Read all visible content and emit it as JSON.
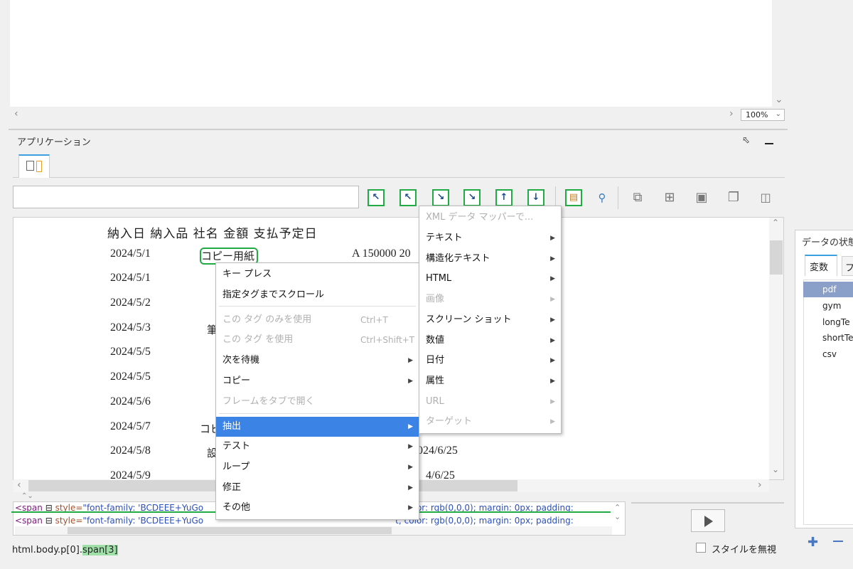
{
  "zoom": "100%",
  "panel_title": "アプリケーション",
  "document": {
    "header": "納入日 納入品 社名 金額 支払予定日",
    "rows": [
      {
        "date": "2024/5/1",
        "item": "コピー用紙",
        "tail": "A 150000 20"
      },
      {
        "date": "2024/5/1",
        "item": "",
        "tail": ""
      },
      {
        "date": "2024/5/2",
        "item": "",
        "tail": ""
      },
      {
        "date": "2024/5/3",
        "item": "筆",
        "tail": ""
      },
      {
        "date": "2024/5/5",
        "item": "",
        "tail": ""
      },
      {
        "date": "2024/5/5",
        "item": "",
        "tail": ""
      },
      {
        "date": "2024/5/6",
        "item": "",
        "tail": ""
      },
      {
        "date": "2024/5/7",
        "item": "コピ",
        "tail": ""
      },
      {
        "date": "2024/5/8",
        "item": "設",
        "tail": "024/6/25"
      },
      {
        "date": "2024/5/9",
        "item": "",
        "tail": "4/6/25"
      }
    ]
  },
  "context_menu": {
    "items": [
      {
        "label": "キー プレス",
        "disabled": false,
        "submenu": false
      },
      {
        "label": "指定タグまでスクロール",
        "disabled": false,
        "submenu": false
      },
      {
        "label": "この タグ のみを使用",
        "shortcut": "Ctrl+T",
        "disabled": true,
        "submenu": false
      },
      {
        "label": "この タグ を使用",
        "shortcut": "Ctrl+Shift+T",
        "disabled": true,
        "submenu": false
      },
      {
        "label": "次を待機",
        "disabled": false,
        "submenu": true
      },
      {
        "label": "コピー",
        "disabled": false,
        "submenu": true
      },
      {
        "label": "フレームをタブで開く",
        "disabled": true,
        "submenu": false
      },
      {
        "label": "抽出",
        "disabled": false,
        "submenu": true,
        "active": true
      },
      {
        "label": "テスト",
        "disabled": false,
        "submenu": true
      },
      {
        "label": "ループ",
        "disabled": false,
        "submenu": true
      },
      {
        "label": "修正",
        "disabled": false,
        "submenu": true
      },
      {
        "label": "その他",
        "disabled": false,
        "submenu": true
      }
    ]
  },
  "submenu": {
    "items": [
      {
        "label": "XML データ マッパーで...",
        "disabled": true
      },
      {
        "label": "テキスト",
        "disabled": false
      },
      {
        "label": "構造化テキスト",
        "disabled": false
      },
      {
        "label": "HTML",
        "disabled": false
      },
      {
        "label": "画像",
        "disabled": true
      },
      {
        "label": "スクリーン ショット",
        "disabled": false
      },
      {
        "label": "数値",
        "disabled": false
      },
      {
        "label": "日付",
        "disabled": false
      },
      {
        "label": "属性",
        "disabled": false
      },
      {
        "label": "URL",
        "disabled": true
      },
      {
        "label": "ターゲット",
        "disabled": true
      }
    ]
  },
  "source": {
    "line1": {
      "tag": "<span",
      "attr": "style=",
      "val": "\"font-family: 'BCDEEE+YuGo",
      "rest": "t; color: rgb(0,0,0); margin: 0px; padding:"
    },
    "line2": {
      "tag": "<span",
      "attr": "style=",
      "val": "\"font-family: 'BCDEEE+YuGo",
      "rest": "t; color: rgb(0,0,0); margin: 0px; padding:"
    }
  },
  "breadcrumb": {
    "path": "html.body.p[0].",
    "last": "span[3]"
  },
  "ignore_style_label": "スタイルを無視",
  "data_panel": {
    "title": "データの状態",
    "tabs": [
      "変数",
      "フ"
    ],
    "variables": [
      "pdf",
      "gym",
      "longTe",
      "shortTe",
      "csv"
    ]
  }
}
